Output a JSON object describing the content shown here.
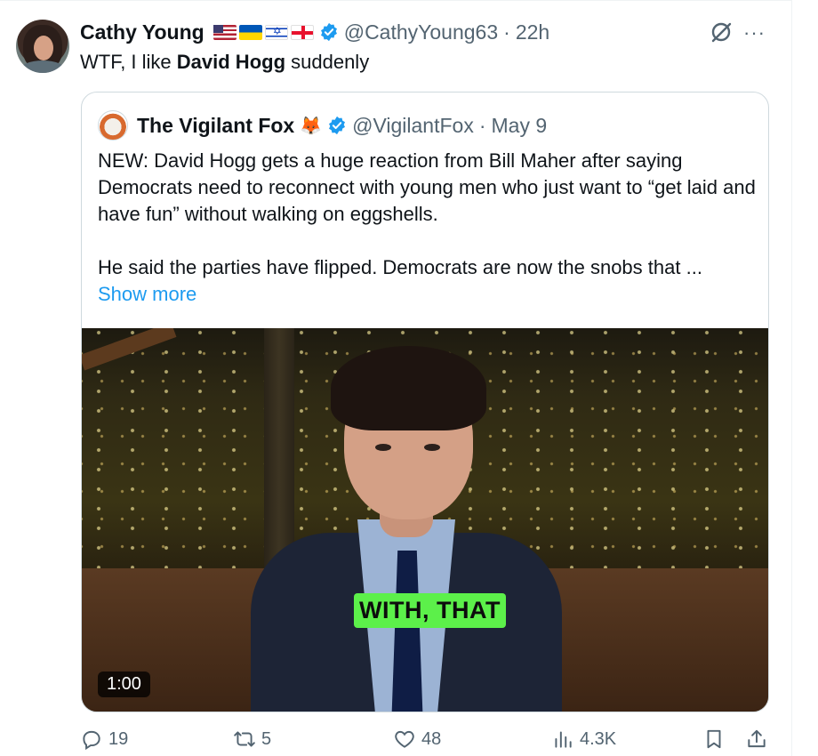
{
  "tweet": {
    "author_name": "Cathy Young",
    "handle": "@CathyYoung63",
    "time": "22h",
    "separator": "·",
    "text_before": "WTF, I like ",
    "text_bold": "David Hogg",
    "text_after": " suddenly",
    "more_label": "···"
  },
  "quote": {
    "author_name": "The Vigilant Fox",
    "emoji": "🦊",
    "handle": "@VigilantFox",
    "separator": "·",
    "date": "May 9",
    "paragraph1": "NEW: David Hogg gets a huge reaction from Bill Maher after saying Democrats need to reconnect with young men who just want to “get laid and have fun” without walking on eggshells.",
    "paragraph2": "He said the parties have flipped. Democrats are now the snobs that ...",
    "show_more": "Show more",
    "video": {
      "caption": "WITH, THAT",
      "duration": "1:00"
    }
  },
  "actions": {
    "replies": "19",
    "reposts": "5",
    "likes": "48",
    "views": "4.3K"
  },
  "colors": {
    "accent": "#1d9bf0",
    "muted": "#536471",
    "caption_bg": "#5cf04a"
  },
  "icons": [
    "grok-icon",
    "more-icon",
    "verified-icon",
    "reply-icon",
    "repost-icon",
    "like-icon",
    "views-icon",
    "bookmark-icon",
    "share-icon"
  ]
}
